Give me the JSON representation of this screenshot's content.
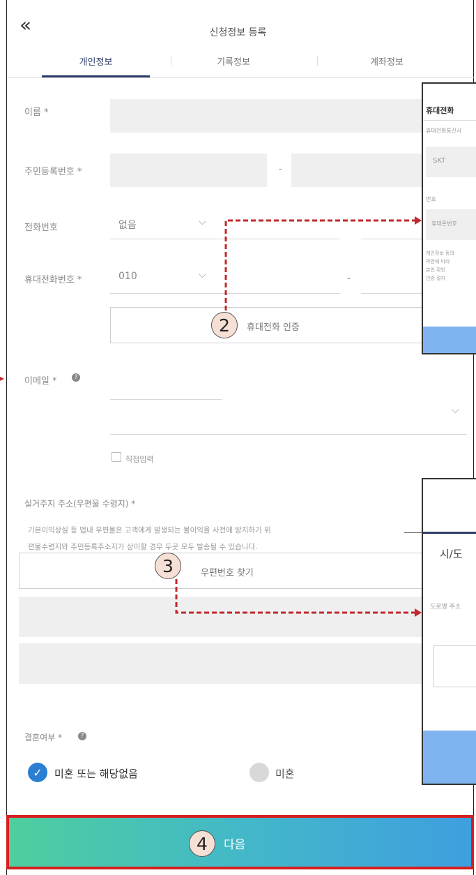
{
  "header": {
    "back_icon": "«",
    "title": "신청정보 등록"
  },
  "tabs": [
    {
      "label": "개인정보",
      "active": true
    },
    {
      "label": "기록정보",
      "active": false
    },
    {
      "label": "계좌정보",
      "active": false
    }
  ],
  "form": {
    "name_label": "이름 *",
    "rrn_label": "주민등록번호 *",
    "rrn_dash": "-",
    "phone_label": "전화번호",
    "phone_select": "없음",
    "mobile_label": "휴대전화번호 *",
    "mobile_select": "010",
    "dash": "-",
    "verify_button": "휴대전화 인증",
    "email_label": "이메일 *",
    "direct_input_label": "직접입력",
    "address_label": "실거주지 주소(우편물 수령지) *",
    "address_note_line1": "기본이익상실 등 법내 우편물은 고객에게 발생되는 불이익을 사전에 방지하기 위",
    "address_note_line2": "편물수령지와 주민등록주소지가 상이할 경우 두곳 모두 발송될 수 있습니다.",
    "postcode_button": "우편번호 찾기",
    "marital_label": "결혼여부 *",
    "option_unmarried": "미혼 또는 해당없음",
    "option_married": "미혼"
  },
  "annotations": {
    "step2": "2",
    "step3": "3",
    "step4": "4"
  },
  "popup1": {
    "title": "휴대전화",
    "carrier_label": "휴대전화통신사",
    "carrier_value": "SKT",
    "number_label": "번호",
    "number_placeholder": "휴대폰번호",
    "notice_line1": "개인정보 동의",
    "notice_line2": "약관에 따라",
    "notice_line3": "본인 확인",
    "notice_line4": "인증 절차"
  },
  "popup2": {
    "field_text": "시/도",
    "search_label": "도로명 주소"
  },
  "footer": {
    "next_button": "다음"
  },
  "colors": {
    "accent_navy": "#2d3b66",
    "highlight_red": "#d61f1f",
    "check_blue": "#2a7fd3"
  }
}
